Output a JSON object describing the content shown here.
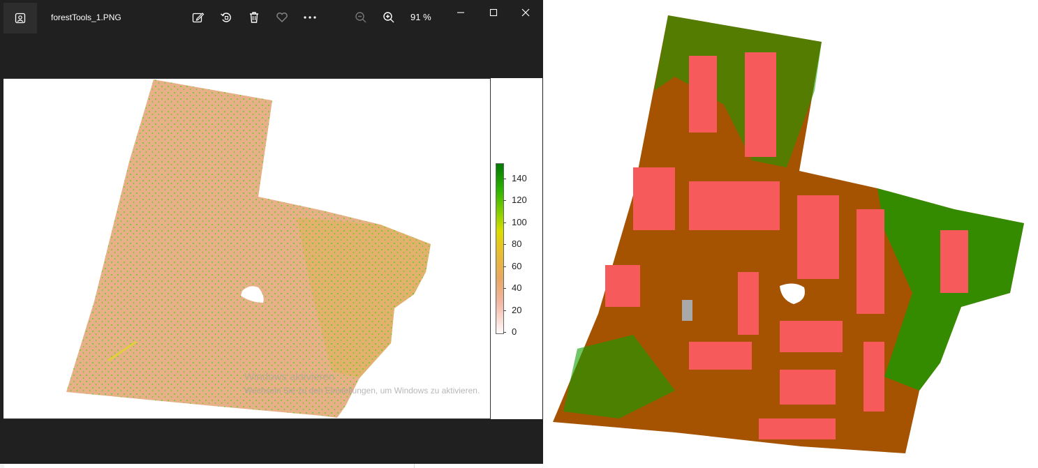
{
  "viewer": {
    "file_name": "forestTools_1.PNG",
    "zoom_level": "91 %",
    "icons": {
      "app": "image-icon",
      "edit": "edit-icon",
      "rotate": "rotate-icon",
      "delete": "trash-icon",
      "favorite": "heart-icon",
      "more": "more-icon",
      "zoom_out": "zoom-out-icon",
      "zoom_in": "zoom-in-icon",
      "minimize": "minimize-icon",
      "maximize": "maximize-icon",
      "close": "close-icon"
    }
  },
  "legend": {
    "labels": [
      "140",
      "120",
      "100",
      "80",
      "60",
      "40",
      "20",
      "0"
    ]
  },
  "watermark": {
    "line1": "Windows aktivieren",
    "line2": "Wechseln Sie zu den Einstellungen, um Windows zu aktivieren."
  },
  "colors": {
    "viewer_bg": "#202020",
    "ground": "#a55300",
    "vegetation": "#109e00",
    "building": "#f75a5a",
    "unclassified": "#a9a9a9"
  }
}
